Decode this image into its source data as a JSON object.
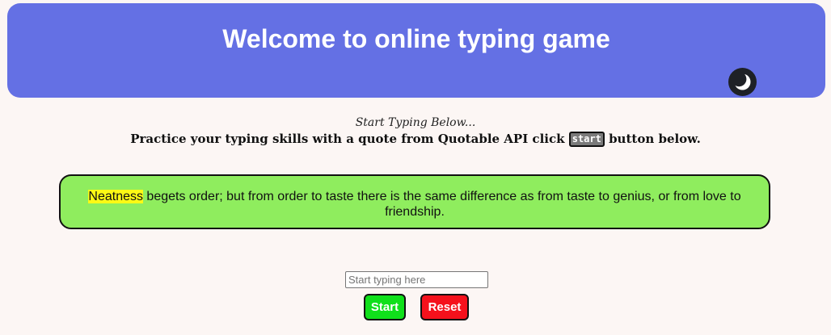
{
  "header": {
    "title": "Welcome to online typing game",
    "theme_icon": "moon-icon"
  },
  "intro": {
    "hint": "Start Typing Below...",
    "instruction_before": "Practice your typing skills with a quote from Quotable API click ",
    "instruction_key": "start",
    "instruction_after": " button below."
  },
  "quote": {
    "current_word": "Neatness",
    "rest": " begets order; but from order to taste there is the same difference as from taste to genius, or from love to friendship."
  },
  "input": {
    "placeholder": "Start typing here",
    "value": ""
  },
  "buttons": {
    "start_label": "Start",
    "reset_label": "Reset"
  },
  "colors": {
    "header_bg": "#6470e4",
    "quote_bg": "#8fed5e",
    "highlight": "#fcf915",
    "start_bg": "#10e01b",
    "reset_bg": "#f5111c",
    "page_bg": "#fcf6f4"
  }
}
